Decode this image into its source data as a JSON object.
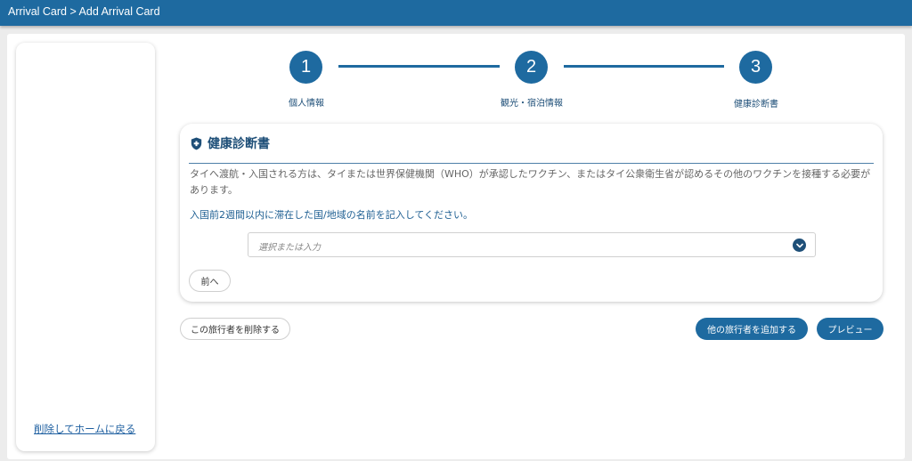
{
  "header": {
    "breadcrumb": "Arrival Card > Add Arrival Card"
  },
  "sidebar": {
    "delete_home_link": "削除してホームに戻る"
  },
  "stepper": {
    "steps": [
      {
        "number": "1",
        "label": "個人情報"
      },
      {
        "number": "2",
        "label": "観光・宿泊情報"
      },
      {
        "number": "3",
        "label": "健康診断書"
      }
    ]
  },
  "health_form": {
    "title": "健康診断書",
    "description": "タイへ渡航・入国される方は、タイまたは世界保健機関（WHO）が承認したワクチン、またはタイ公衆衛生省が認めるその他のワクチンを接種する必要があります。",
    "question": "入国前2週間以内に滞在した国/地域の名前を記入してください。",
    "select_placeholder": "選択または入力",
    "back_button": "前へ"
  },
  "actions": {
    "delete_traveler": "この旅行者を削除する",
    "add_traveler": "他の旅行者を追加する",
    "preview": "プレビュー"
  },
  "colors": {
    "brand": "#1e6aa0",
    "brand_dark": "#1e4f78"
  },
  "icons": {
    "title_icon": "shield-icon",
    "select_icon": "chevron-down-icon"
  }
}
